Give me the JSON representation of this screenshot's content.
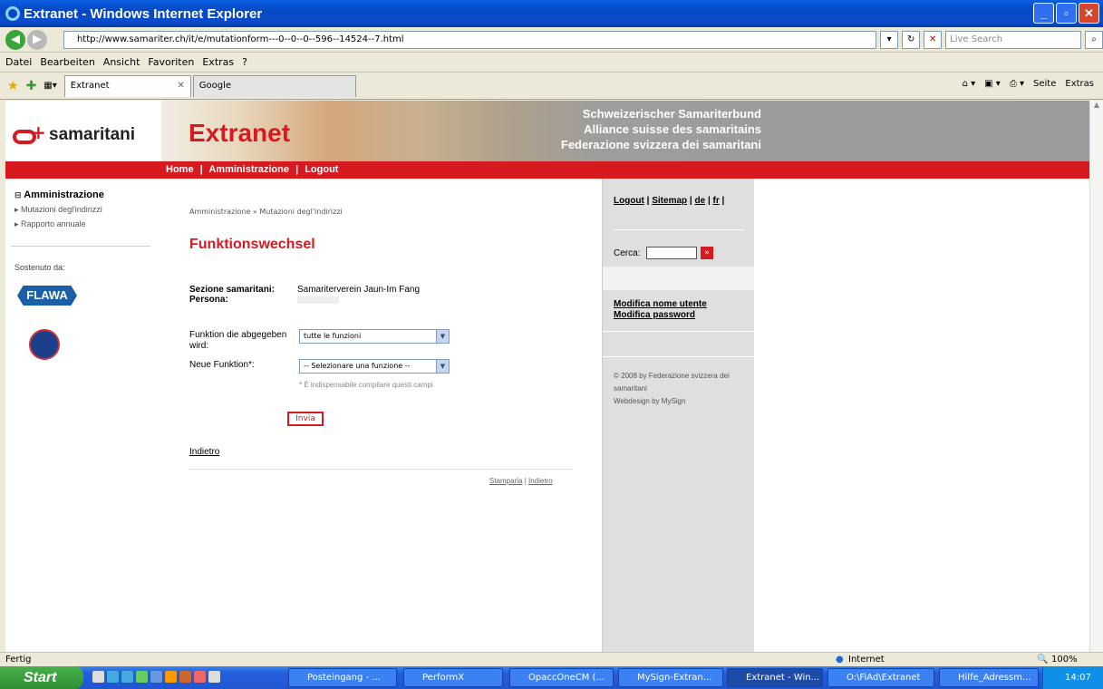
{
  "window": {
    "title": "Extranet - Windows Internet Explorer"
  },
  "address": {
    "url": "http://www.samariter.ch/it/e/mutationform---0--0--0--596--14524--7.html",
    "search_placeholder": "Live Search"
  },
  "menu": [
    "Datei",
    "Bearbeiten",
    "Ansicht",
    "Favoriten",
    "Extras",
    "?"
  ],
  "tabs": [
    {
      "label": "Extranet"
    },
    {
      "label": "Google"
    }
  ],
  "tab_tools": {
    "page": "Seite",
    "tools": "Extras"
  },
  "logo": {
    "text": "samaritani"
  },
  "banner": {
    "title": "Extranet",
    "line1": "Schweizerischer Samariterbund",
    "line2": "Alliance suisse des samaritains",
    "line3": "Federazione svizzera dei samaritani"
  },
  "nav": {
    "home": "Home",
    "admin": "Amministrazione",
    "logout": "Logout",
    "sep": "|"
  },
  "sidebar": {
    "heading": "Amministrazione",
    "items": [
      "Mutazioni degl'indirizzi",
      "Rapporto annuale"
    ],
    "sponsor_label": "Sostenuto da:",
    "sponsor1": "FLAWA"
  },
  "main": {
    "breadcrumb": "Amministrazione » Mutazioni degl'indirizzi",
    "title": "Funktionswechsel",
    "section_label": "Sezione samaritani:",
    "section_value": "Samariterverein Jaun-Im Fang",
    "person_label": "Persona:",
    "func_label": "Funktion die abgegeben wird:",
    "func_value": "tutte le funzioni",
    "new_func_label": "Neue Funktion*:",
    "new_func_value": "-- Selezionare una funzione --",
    "required_note": "* È indispensabile compilare questi campi",
    "submit": "Invia",
    "back": "Indietro",
    "footer_print": "Stamparla",
    "footer_back": "Indietro"
  },
  "right": {
    "logout": "Logout",
    "sitemap": "Sitemap",
    "de": "de",
    "fr": "fr",
    "search_label": "Cerca:",
    "modify_user": "Modifica nome utente",
    "modify_pw": "Modifica password",
    "copyright": "© 2008 by Federazione svizzera dei samaritani",
    "webdesign": "Webdesign by MySign"
  },
  "status": {
    "text": "Fertig",
    "zone": "Internet",
    "zoom": "100%"
  },
  "taskbar": {
    "start": "Start",
    "items": [
      "Posteingang - ...",
      "PerformX",
      "OpaccOneCM (...",
      "MySign-Extran...",
      "Extranet - Win...",
      "O:\\FiAd\\Extranet",
      "Hilfe_Adressm..."
    ],
    "clock": "14:07"
  }
}
